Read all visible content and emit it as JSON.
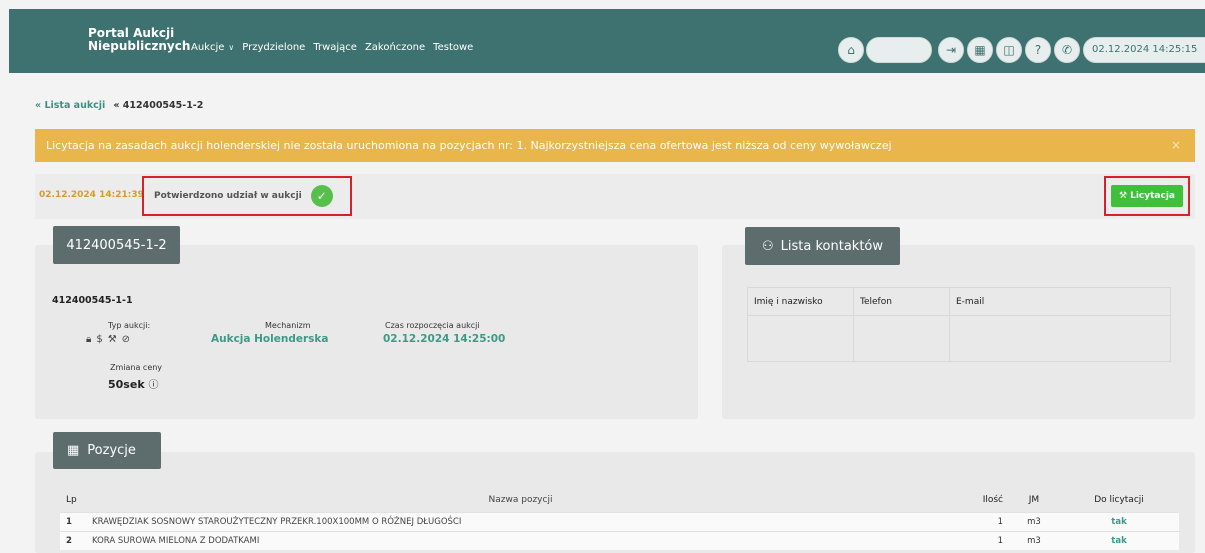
{
  "header": {
    "brand": "Portal Aukcji\nNiepublicznych",
    "nav": [
      {
        "label": "Aukcje",
        "has_dropdown": true
      },
      {
        "label": "Przydzielone"
      },
      {
        "label": "Trwające"
      },
      {
        "label": "Zakończone"
      },
      {
        "label": "Testowe"
      }
    ],
    "datetime": "02.12.2024 14:25:15",
    "icons": [
      "home-icon",
      "logout-icon",
      "calculator-icon",
      "book-icon",
      "help-icon",
      "phone-icon"
    ]
  },
  "breadcrumb": {
    "back_label": "Lista aukcji",
    "current": "412400545-1-2"
  },
  "alert": {
    "text": "Licytacja na zasadach aukcji holenderskiej nie została uruchomiona na pozycjach nr: 1. Najkorzystniejsza cena ofertowa jest niższa od ceny wywoławczej",
    "close": "×"
  },
  "status": {
    "time": "02.12.2024 14:21:39",
    "confirm_text": "Potwierdzono udział w aukcji",
    "bid_button": "Licytacja"
  },
  "auction": {
    "tab_title": "412400545-1-2",
    "id": "412400545-1-1",
    "type_label": "Typ aukcji:",
    "type_icons": "🔒 $ ⚒ ⊘",
    "mechanism_label": "Mechanizm",
    "mechanism_value": "Aukcja Holenderska",
    "start_label": "Czas rozpoczęcia aukcji",
    "start_value": "02.12.2024 14:25:00",
    "price_change_label": "Zmiana ceny",
    "price_change_value": "50sek"
  },
  "contacts": {
    "tab_title": "Lista kontaktów",
    "columns": [
      "Imię i nazwisko",
      "Telefon",
      "E-mail"
    ]
  },
  "positions": {
    "tab_title": "Pozycje",
    "columns": {
      "lp": "Lp",
      "name": "Nazwa pozycji",
      "qty": "Ilość",
      "jm": "JM",
      "bid": "Do licytacji"
    },
    "rows": [
      {
        "lp": "1",
        "name": "KRAWĘDZIAK SOSNOWY STAROUŻYTECZNY PRZEKR.100X100MM O RÓŻNEJ DŁUGOŚCI",
        "qty": "1",
        "jm": "m3",
        "bid": "tak"
      },
      {
        "lp": "2",
        "name": "KORA SUROWA MIELONA Z DODATKAMI",
        "qty": "1",
        "jm": "m3",
        "bid": "tak"
      }
    ]
  },
  "colors": {
    "header": "#3d7270",
    "alert": "#e8b64a",
    "success": "#3fbf3a",
    "highlight": "#d8202a"
  }
}
